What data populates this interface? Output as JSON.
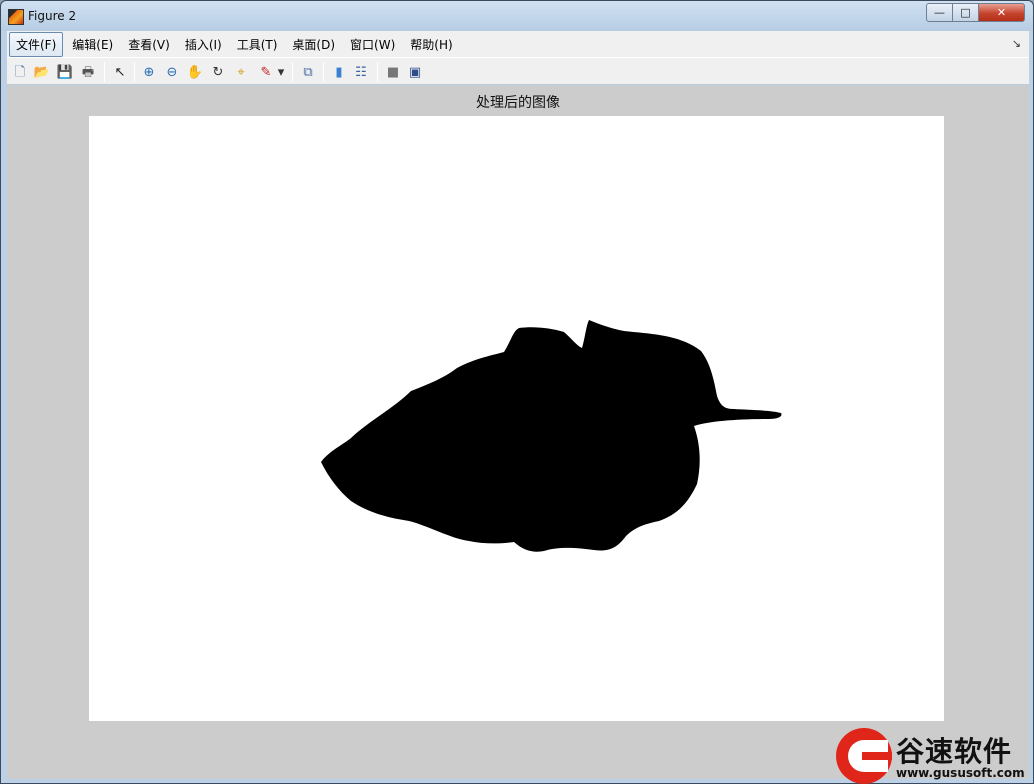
{
  "window": {
    "title": "Figure 2",
    "controls": {
      "minimize": "—",
      "maximize": "□",
      "close": "✕"
    }
  },
  "menubar": {
    "items": [
      {
        "label": "文件(F)",
        "active": true
      },
      {
        "label": "编辑(E)"
      },
      {
        "label": "查看(V)"
      },
      {
        "label": "插入(I)"
      },
      {
        "label": "工具(T)"
      },
      {
        "label": "桌面(D)"
      },
      {
        "label": "窗口(W)"
      },
      {
        "label": "帮助(H)"
      }
    ],
    "overflow": "↘"
  },
  "toolbar": {
    "buttons": [
      {
        "icon": "new-figure-icon",
        "glyph": "🗋",
        "color": "#4a6fa5"
      },
      {
        "icon": "open-file-icon",
        "glyph": "📂",
        "color": "#d6a21e"
      },
      {
        "icon": "save-icon",
        "glyph": "💾",
        "color": "#2c4f8a"
      },
      {
        "icon": "print-icon",
        "glyph": "🖶",
        "color": "#555555"
      },
      {
        "icon": "edit-plot-arrow-icon",
        "glyph": "↖",
        "color": "#222222"
      },
      {
        "icon": "zoom-in-icon",
        "glyph": "⊕",
        "color": "#2a6db5"
      },
      {
        "icon": "zoom-out-icon",
        "glyph": "⊖",
        "color": "#2a6db5"
      },
      {
        "icon": "pan-hand-icon",
        "glyph": "✋",
        "color": "#8a5a2a"
      },
      {
        "icon": "rotate-3d-icon",
        "glyph": "↻",
        "color": "#333333"
      },
      {
        "icon": "data-cursor-icon",
        "glyph": "⌖",
        "color": "#d4a020"
      },
      {
        "icon": "brush-icon",
        "glyph": "✎",
        "color": "#c82020"
      },
      {
        "icon": "brush-dropdown-icon",
        "glyph": "▾",
        "color": "#333333"
      },
      {
        "icon": "link-plot-icon",
        "glyph": "⧉",
        "color": "#4a6fa5"
      },
      {
        "icon": "insert-colorbar-icon",
        "glyph": "▮",
        "color": "#3a7fd0"
      },
      {
        "icon": "insert-legend-icon",
        "glyph": "☷",
        "color": "#3a5fa5"
      },
      {
        "icon": "hide-plot-tools-icon",
        "glyph": "■",
        "color": "#777777"
      },
      {
        "icon": "show-plot-tools-icon",
        "glyph": "▣",
        "color": "#2c4f8a"
      }
    ]
  },
  "axes": {
    "title": "处理后的图像",
    "image_description_colors": {
      "background": "#ffffff",
      "shape": "#000000"
    }
  },
  "watermark": {
    "name": "谷速软件",
    "url": "www.gususoft.com",
    "brand_color": "#e0261b"
  }
}
